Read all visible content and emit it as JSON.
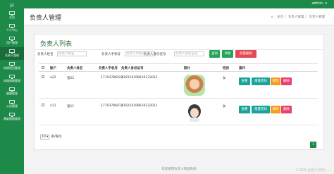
{
  "app": {
    "logo": "μ",
    "user": "admin",
    "user_caret": "▾",
    "footer": "欢迎使用负责人管理系统",
    "watermark": "CSDN @普几何叫……"
  },
  "sidebar": {
    "items": [
      {
        "label": "主页",
        "icon": "monitor-icon"
      },
      {
        "label": "个人中心",
        "icon": "monitor-icon"
      },
      {
        "label": "用户管理",
        "icon": "monitor-icon"
      },
      {
        "label": "负责人管理",
        "icon": "monitor-icon",
        "active": true
      },
      {
        "label": "体测项目管理",
        "icon": "monitor-icon"
      },
      {
        "label": "体测成绩管理",
        "icon": "monitor-icon"
      },
      {
        "label": "健康管理",
        "icon": "monitor-icon"
      },
      {
        "label": "公告管理",
        "icon": "monitor-icon"
      },
      {
        "label": "基础数据管理",
        "icon": "monitor-icon"
      }
    ]
  },
  "header": {
    "title": "负责人管理",
    "breadcrumb": [
      "主页",
      "负责人管理",
      "负责人管理"
    ]
  },
  "panel": {
    "title": "负责人列表"
  },
  "search": {
    "name_label": "负责人姓名",
    "name_placeholder": "负责人姓名",
    "phone_label": "负责人手机号",
    "phone_placeholder": "负责人手机号",
    "idcard_label": "负责人身份证号",
    "idcard_placeholder": "负责人身份证号",
    "search_btn": "查询",
    "add_btn": "添加",
    "batch_delete_btn": "批量删除"
  },
  "table": {
    "headers": [
      "账户",
      "负责人姓名",
      "负责人手机号",
      "负责人身份证号",
      "照片",
      "性别",
      "操作"
    ],
    "rows": [
      {
        "account": "a22",
        "name": "张22",
        "phone": "17703786022",
        "idcard": "410224199610232022",
        "gender": "女"
      },
      {
        "account": "a11",
        "name": "张11",
        "phone": "17703786011",
        "idcard": "410224199610232011",
        "gender": "女"
      }
    ],
    "actions": {
      "view": "查看",
      "reset": "重置密码",
      "edit": "修改",
      "delete": "删除"
    }
  },
  "pager": {
    "size": "10",
    "size_caret": "▾",
    "suffix": "条/每页",
    "current": "1"
  },
  "colors": {
    "primary": "#1e8a4a",
    "danger": "#e14a55",
    "teal": "#1aa39a",
    "orange": "#f09d1e",
    "pink": "#e7426b"
  }
}
